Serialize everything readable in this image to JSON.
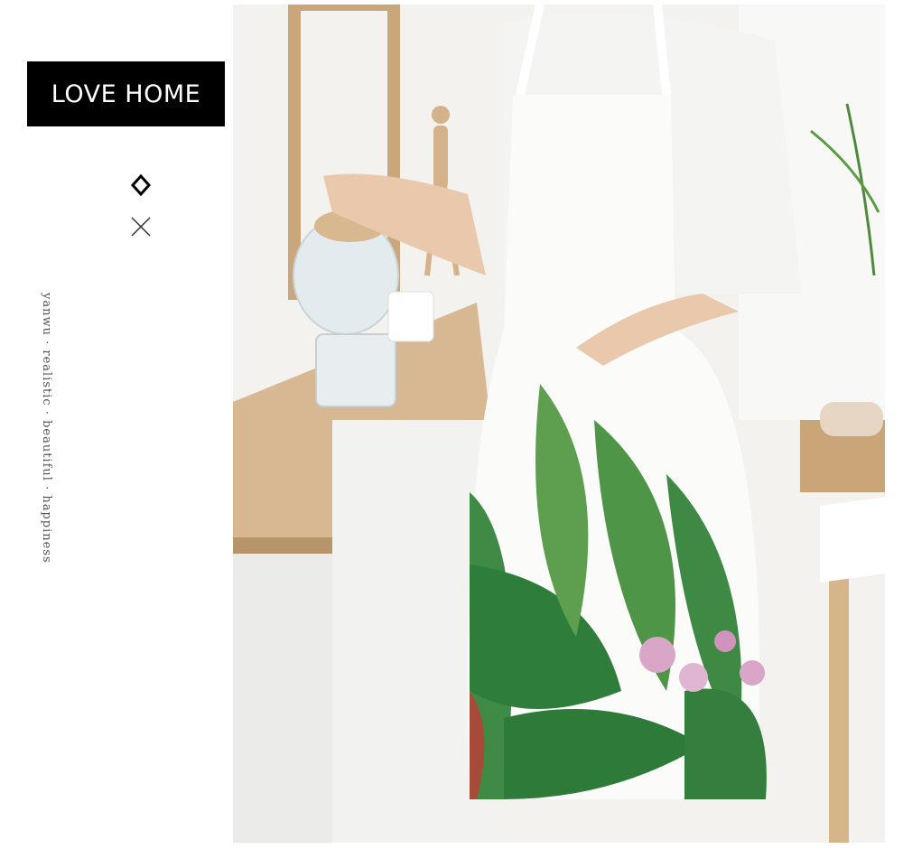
{
  "brand": {
    "label": "LOVE HOME"
  },
  "tagline": {
    "text": "yanwu · realistic · beautiful · happiness"
  },
  "icons": {
    "decor_top": "diamond-icon",
    "decor_bottom": "cross-icon"
  },
  "colors": {
    "brand_bg": "#000000",
    "brand_text": "#ffffff",
    "tagline": "#555555"
  },
  "photo": {
    "subject": "woman in white botanical print apron in kitchen"
  }
}
